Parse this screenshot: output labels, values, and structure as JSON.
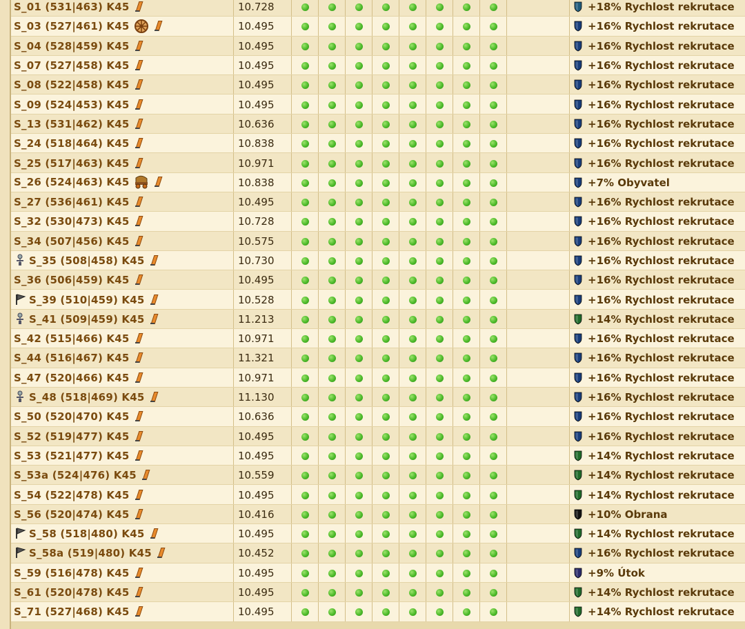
{
  "rows": [
    {
      "name": "S_01 (531|463) K45",
      "points": "10.728",
      "bonus": "+18% Rychlost rekrutace",
      "shield": "#1f5a7a",
      "icon": ""
    },
    {
      "name": "S_03 (527|461) K45",
      "points": "10.495",
      "bonus": "+16% Rychlost rekrutace",
      "shield": "#173c7a",
      "icon": "wheel-icon",
      "icon_pos": "after"
    },
    {
      "name": "S_04 (528|459) K45",
      "points": "10.495",
      "bonus": "+16% Rychlost rekrutace",
      "shield": "#173c7a",
      "icon": ""
    },
    {
      "name": "S_07 (527|458) K45",
      "points": "10.495",
      "bonus": "+16% Rychlost rekrutace",
      "shield": "#173c7a",
      "icon": ""
    },
    {
      "name": "S_08 (522|458) K45",
      "points": "10.495",
      "bonus": "+16% Rychlost rekrutace",
      "shield": "#173c7a",
      "icon": ""
    },
    {
      "name": "S_09 (524|453) K45",
      "points": "10.495",
      "bonus": "+16% Rychlost rekrutace",
      "shield": "#173c7a",
      "icon": ""
    },
    {
      "name": "S_13 (531|462) K45",
      "points": "10.636",
      "bonus": "+16% Rychlost rekrutace",
      "shield": "#173c7a",
      "icon": ""
    },
    {
      "name": "S_24 (518|464) K45",
      "points": "10.838",
      "bonus": "+16% Rychlost rekrutace",
      "shield": "#173c7a",
      "icon": ""
    },
    {
      "name": "S_25 (517|463) K45",
      "points": "10.971",
      "bonus": "+16% Rychlost rekrutace",
      "shield": "#173c7a",
      "icon": ""
    },
    {
      "name": "S_26 (524|463) K45",
      "points": "10.838",
      "bonus": "+7% Obyvatel",
      "shield": "#173c7a",
      "icon": "wagon-icon",
      "icon_pos": "after"
    },
    {
      "name": "S_27 (536|461) K45",
      "points": "10.495",
      "bonus": "+16% Rychlost rekrutace",
      "shield": "#173c7a",
      "icon": ""
    },
    {
      "name": "S_32 (530|473) K45",
      "points": "10.728",
      "bonus": "+16% Rychlost rekrutace",
      "shield": "#173c7a",
      "icon": ""
    },
    {
      "name": "S_34 (507|456) K45",
      "points": "10.575",
      "bonus": "+16% Rychlost rekrutace",
      "shield": "#173c7a",
      "icon": ""
    },
    {
      "name": "S_35 (508|458) K45",
      "points": "10.730",
      "bonus": "+16% Rychlost rekrutace",
      "shield": "#173c7a",
      "icon": "sword-icon",
      "icon_pos": "before"
    },
    {
      "name": "S_36 (506|459) K45",
      "points": "10.495",
      "bonus": "+16% Rychlost rekrutace",
      "shield": "#173c7a",
      "icon": ""
    },
    {
      "name": "S_39 (510|459) K45",
      "points": "10.528",
      "bonus": "+16% Rychlost rekrutace",
      "shield": "#173c7a",
      "icon": "flag-icon",
      "icon_pos": "before"
    },
    {
      "name": "S_41 (509|459) K45",
      "points": "11.213",
      "bonus": "+14% Rychlost rekrutace",
      "shield": "#1f6a2a",
      "icon": "sword-icon",
      "icon_pos": "before"
    },
    {
      "name": "S_42 (515|466) K45",
      "points": "10.971",
      "bonus": "+16% Rychlost rekrutace",
      "shield": "#173c7a",
      "icon": ""
    },
    {
      "name": "S_44 (516|467) K45",
      "points": "11.321",
      "bonus": "+16% Rychlost rekrutace",
      "shield": "#173c7a",
      "icon": ""
    },
    {
      "name": "S_47 (520|466) K45",
      "points": "10.971",
      "bonus": "+16% Rychlost rekrutace",
      "shield": "#173c7a",
      "icon": ""
    },
    {
      "name": "S_48 (518|469) K45",
      "points": "11.130",
      "bonus": "+16% Rychlost rekrutace",
      "shield": "#173c7a",
      "icon": "sword-icon",
      "icon_pos": "before"
    },
    {
      "name": "S_50 (520|470) K45",
      "points": "10.636",
      "bonus": "+16% Rychlost rekrutace",
      "shield": "#173c7a",
      "icon": ""
    },
    {
      "name": "S_52 (519|477) K45",
      "points": "10.495",
      "bonus": "+16% Rychlost rekrutace",
      "shield": "#173c7a",
      "icon": ""
    },
    {
      "name": "S_53 (521|477) K45",
      "points": "10.495",
      "bonus": "+14% Rychlost rekrutace",
      "shield": "#1f6a2a",
      "icon": ""
    },
    {
      "name": "S_53a (524|476) K45",
      "points": "10.559",
      "bonus": "+14% Rychlost rekrutace",
      "shield": "#1f6a2a",
      "icon": ""
    },
    {
      "name": "S_54 (522|478) K45",
      "points": "10.495",
      "bonus": "+14% Rychlost rekrutace",
      "shield": "#1f6a2a",
      "icon": ""
    },
    {
      "name": "S_56 (520|474) K45",
      "points": "10.416",
      "bonus": "+10% Obrana",
      "shield": "#111111",
      "icon": ""
    },
    {
      "name": "S_58 (518|480) K45",
      "points": "10.495",
      "bonus": "+14% Rychlost rekrutace",
      "shield": "#1f6a2a",
      "icon": "flag-icon",
      "icon_pos": "before"
    },
    {
      "name": "S_58a (519|480) K45",
      "points": "10.452",
      "bonus": "+16% Rychlost rekrutace",
      "shield": "#173c7a",
      "icon": "flag-icon",
      "icon_pos": "before"
    },
    {
      "name": "S_59 (516|478) K45",
      "points": "10.495",
      "bonus": "+9% Útok",
      "shield": "#2a2a6a",
      "icon": ""
    },
    {
      "name": "S_61 (520|478) K45",
      "points": "10.495",
      "bonus": "+14% Rychlost rekrutace",
      "shield": "#1f6a2a",
      "icon": ""
    },
    {
      "name": "S_71 (527|468) K45",
      "points": "10.495",
      "bonus": "+14% Rychlost rekrutace",
      "shield": "#1f6a2a",
      "icon": ""
    }
  ]
}
